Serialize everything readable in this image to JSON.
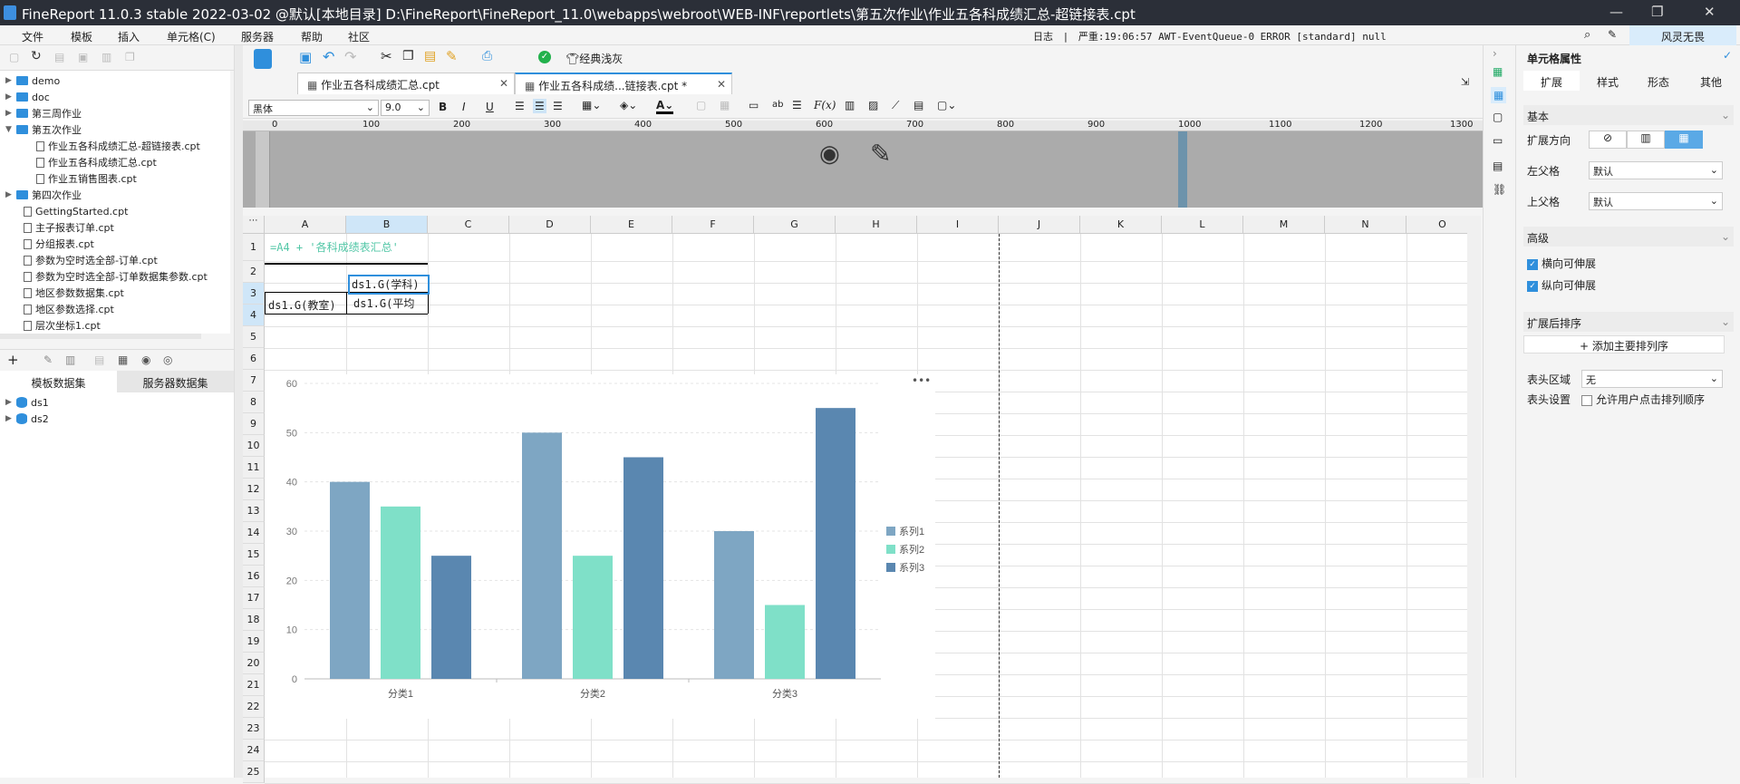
{
  "window": {
    "title": "FineReport 11.0.3 stable 2022-03-02 @默认[本地目录]    D:\\FineReport\\FineReport_11.0\\webapps\\webroot\\WEB-INF\\reportlets\\第五次作业\\作业五各科成绩汇总-超链接表.cpt",
    "min": "—",
    "max": "❐",
    "close": "✕"
  },
  "menu": [
    "文件",
    "模板",
    "插入",
    "单元格(C)",
    "服务器",
    "帮助",
    "社区"
  ],
  "status": {
    "log": "日志",
    "severity": "严重:19:06:57 AWT-EventQueue-0 ERROR [standard] null",
    "user": "风灵无畏"
  },
  "tree": [
    {
      "label": "demo",
      "type": "folder",
      "level": 0
    },
    {
      "label": "doc",
      "type": "folder",
      "level": 0
    },
    {
      "label": "第三周作业",
      "type": "folder",
      "level": 0
    },
    {
      "label": "第五次作业",
      "type": "folder",
      "level": 0,
      "open": true
    },
    {
      "label": "作业五各科成绩汇总-超链接表.cpt",
      "type": "file",
      "level": 1
    },
    {
      "label": "作业五各科成绩汇总.cpt",
      "type": "file",
      "level": 1
    },
    {
      "label": "作业五销售图表.cpt",
      "type": "file",
      "level": 1
    },
    {
      "label": "第四次作业",
      "type": "folder",
      "level": 0
    },
    {
      "label": "GettingStarted.cpt",
      "type": "file",
      "level": 0
    },
    {
      "label": "主子报表订单.cpt",
      "type": "file",
      "level": 0
    },
    {
      "label": "分组报表.cpt",
      "type": "file",
      "level": 0
    },
    {
      "label": "参数为空时选全部-订单.cpt",
      "type": "file",
      "level": 0
    },
    {
      "label": "参数为空时选全部-订单数据集参数.cpt",
      "type": "file",
      "level": 0
    },
    {
      "label": "地区参数数据集.cpt",
      "type": "file",
      "level": 0
    },
    {
      "label": "地区参数选择.cpt",
      "type": "file",
      "level": 0
    },
    {
      "label": "层次坐标1.cpt",
      "type": "file",
      "level": 0
    }
  ],
  "datasets": {
    "tabs": [
      "模板数据集",
      "服务器数据集"
    ],
    "items": [
      "ds1",
      "ds2"
    ]
  },
  "toolbar": {
    "classic": "经典浅灰",
    "font": "黑体",
    "size": "9.0"
  },
  "doc_tabs": [
    "作业五各科成绩汇总.cpt",
    "作业五各科成绩...链接表.cpt *"
  ],
  "ruler_marks": [
    "0",
    "100",
    "200",
    "300",
    "400",
    "500",
    "600",
    "700",
    "800",
    "900",
    "1000",
    "1100",
    "1200",
    "1300"
  ],
  "columns": [
    "A",
    "B",
    "C",
    "D",
    "E",
    "F",
    "G",
    "H",
    "I",
    "J",
    "K",
    "L",
    "M",
    "N",
    "O"
  ],
  "rows": [
    "1",
    "2",
    "3",
    "4",
    "5",
    "6",
    "7",
    "8",
    "9",
    "10",
    "11",
    "12",
    "13",
    "14",
    "15",
    "16",
    "17",
    "18",
    "19",
    "20",
    "21",
    "22",
    "23",
    "24",
    "25"
  ],
  "cells": {
    "a1": "=A4 + '各科成绩表汇总'",
    "b3": "ds1.G(学科)",
    "a4": "ds1.G(教室)",
    "b4": "ds1.G(平均"
  },
  "chart_data": {
    "type": "bar",
    "categories": [
      "分类1",
      "分类2",
      "分类3"
    ],
    "series": [
      {
        "name": "系列1",
        "values": [
          40,
          50,
          30
        ],
        "color": "#7ea6c3"
      },
      {
        "name": "系列2",
        "values": [
          35,
          25,
          15
        ],
        "color": "#7fe0c8"
      },
      {
        "name": "系列3",
        "values": [
          25,
          45,
          55
        ],
        "color": "#5a87b0"
      }
    ],
    "ylim": [
      0,
      60
    ],
    "yticks": [
      0,
      10,
      20,
      30,
      40,
      50,
      60
    ],
    "grid": true,
    "legend": "right",
    "more": "•••"
  },
  "panel": {
    "title": "单元格属性",
    "tabs": [
      "扩展",
      "样式",
      "形态",
      "其他"
    ],
    "basic": "基本",
    "expand_dir": "扩展方向",
    "left_parent": "左父格",
    "left_parent_value": "默认",
    "up_parent": "上父格",
    "up_parent_value": "默认",
    "advanced": "高级",
    "h_expand": "横向可伸展",
    "v_expand": "纵向可伸展",
    "sort": "扩展后排序",
    "add_sort": "添加主要排列序",
    "header_area": "表头区域",
    "header_area_value": "无",
    "header_set": "表头设置",
    "allow_sort": "允许用户点击排列顺序"
  }
}
